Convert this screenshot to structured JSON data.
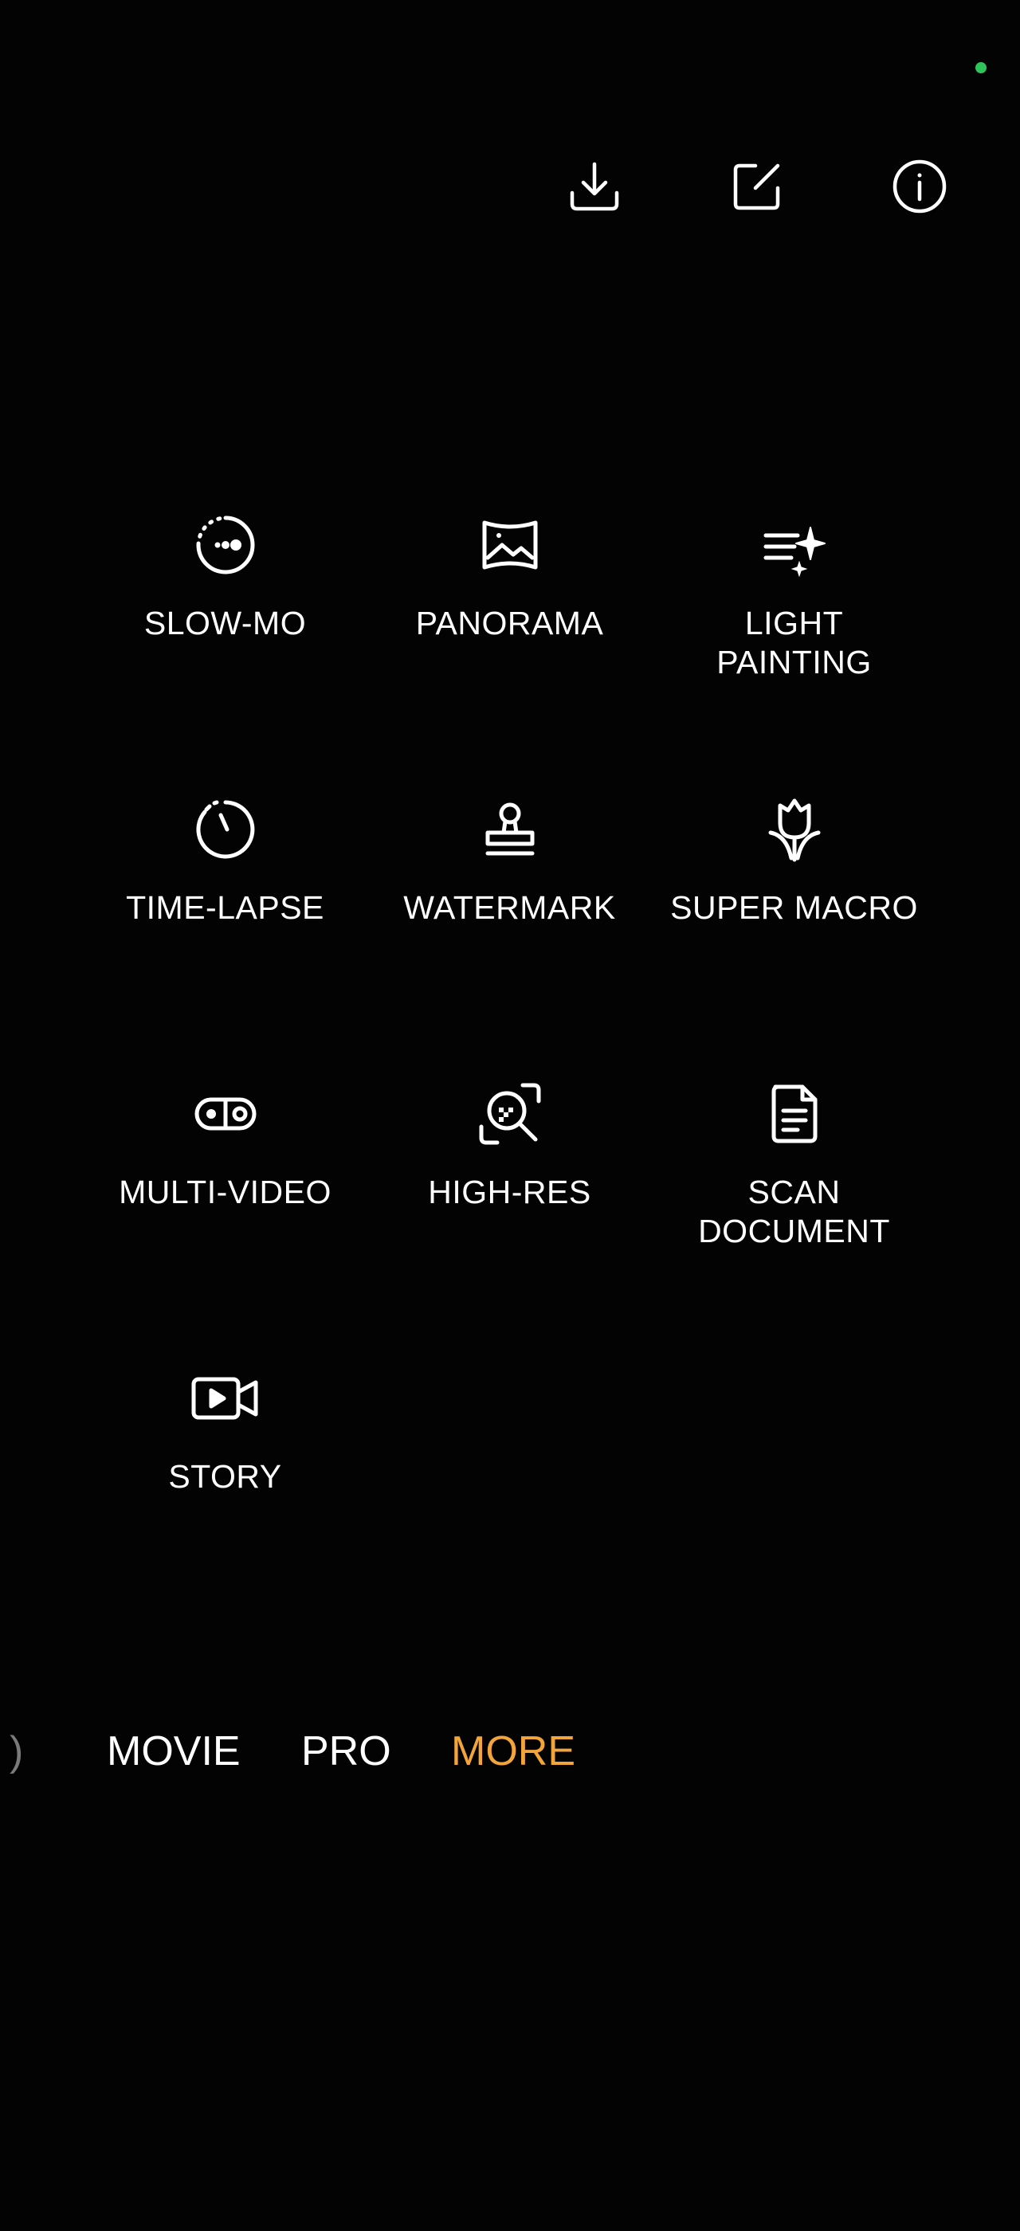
{
  "top_actions": [
    {
      "name": "download-icon"
    },
    {
      "name": "edit-icon"
    },
    {
      "name": "info-icon"
    }
  ],
  "modes": [
    {
      "label": "SLOW-MO",
      "icon": "slow-mo-icon"
    },
    {
      "label": "PANORAMA",
      "icon": "panorama-icon"
    },
    {
      "label": "LIGHT\nPAINTING",
      "icon": "light-painting-icon"
    },
    {
      "label": "TIME-LAPSE",
      "icon": "time-lapse-icon"
    },
    {
      "label": "WATERMARK",
      "icon": "watermark-icon"
    },
    {
      "label": "SUPER MACRO",
      "icon": "super-macro-icon"
    },
    {
      "label": "MULTI-VIDEO",
      "icon": "multi-video-icon"
    },
    {
      "label": "HIGH-RES",
      "icon": "high-res-icon"
    },
    {
      "label": "SCAN\nDOCUMENT",
      "icon": "scan-document-icon"
    },
    {
      "label": "STORY",
      "icon": "story-icon"
    }
  ],
  "mode_bar": {
    "partial": ")",
    "movie": "MOVIE",
    "pro": "PRO",
    "more": "MORE",
    "active": "MORE"
  },
  "colors": {
    "background": "#030303",
    "accent": "#f2a53a",
    "text": "#ffffff",
    "status_dot": "#2ec45b"
  }
}
